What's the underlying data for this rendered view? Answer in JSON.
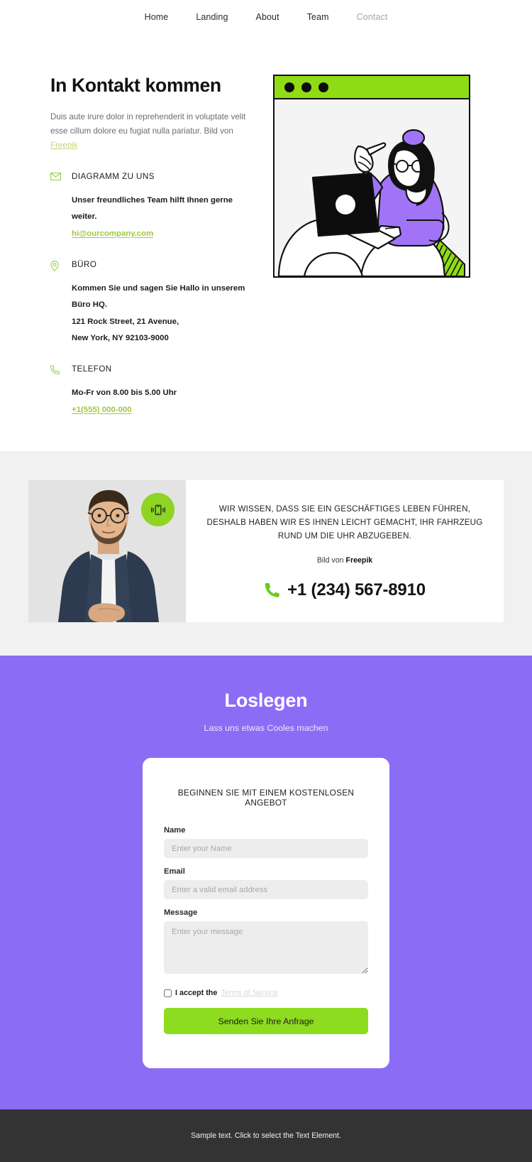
{
  "nav": {
    "items": [
      {
        "label": "Home",
        "active": false
      },
      {
        "label": "Landing",
        "active": false
      },
      {
        "label": "About",
        "active": false
      },
      {
        "label": "Team",
        "active": false
      },
      {
        "label": "Contact",
        "active": true
      }
    ]
  },
  "hero": {
    "title": "In Kontakt kommen",
    "lede_text": "Duis aute irure dolor in reprehenderit in voluptate velit esse cillum dolore eu fugiat nulla pariatur. Bild von ",
    "lede_link": "Freepik",
    "contacts": [
      {
        "icon": "envelope-icon",
        "label": "DIAGRAMM ZU UNS",
        "lines": [
          "Unser freundliches Team hilft Ihnen gerne",
          "weiter."
        ],
        "link": "hi@ourcompany.com"
      },
      {
        "icon": "location-pin-icon",
        "label": "BÜRO",
        "lines": [
          "Kommen Sie und sagen Sie Hallo in unserem",
          "Büro HQ.",
          "121 Rock Street, 21 Avenue,",
          "New York, NY 92103-9000"
        ],
        "link": ""
      },
      {
        "icon": "phone-icon",
        "label": "TELEFON",
        "lines": [
          "Mo-Fr von 8.00 bis 5.00 Uhr"
        ],
        "link": "+1(555) 000-000"
      }
    ]
  },
  "cta": {
    "headline": "WIR WISSEN, DASS SIE EIN GESCHÄFTIGES LEBEN FÜHREN, DESHALB HABEN WIR ES IHNEN LEICHT GEMACHT, IHR FAHRZEUG RUND UM DIE UHR ABZUGEBEN.",
    "credit_prefix": "Bild von ",
    "credit_name": "Freepik",
    "phone": "+1 (234) 567-8910"
  },
  "form_section": {
    "heading": "Loslegen",
    "subheading": "Lass uns etwas Cooles machen",
    "form_title": "BEGINNEN SIE MIT EINEM KOSTENLOSEN ANGEBOT",
    "fields": [
      {
        "label": "Name",
        "placeholder": "Enter your Name"
      },
      {
        "label": "Email",
        "placeholder": "Enter a valid email address"
      },
      {
        "label": "Message",
        "placeholder": "Enter your message"
      }
    ],
    "terms_accept": "I accept the",
    "terms_link": "Terms of Service",
    "submit_label": "Senden Sie Ihre Anfrage"
  },
  "footer": {
    "text": "Sample text. Click to select the Text Element."
  },
  "colors": {
    "green": "#8ddc1f",
    "green_soft": "#9ad04a",
    "purple": "#8b6df5",
    "footer_dark": "#333333",
    "band_gray": "#f1f1f1"
  }
}
